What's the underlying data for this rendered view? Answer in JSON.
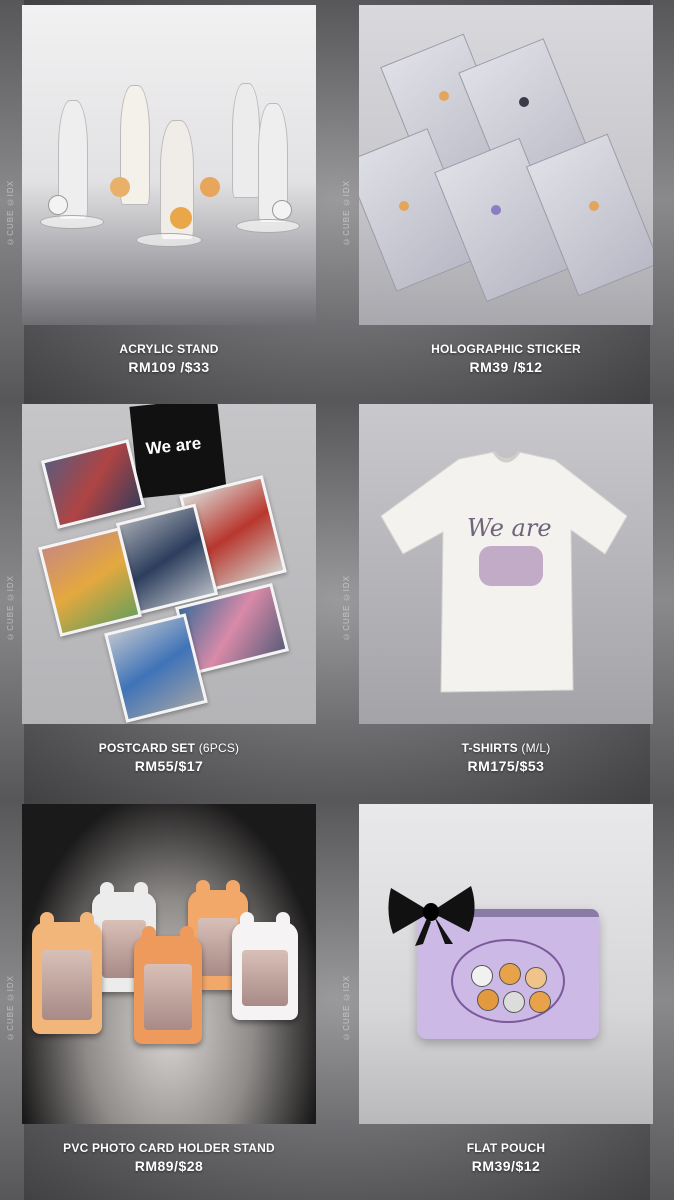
{
  "watermark": "©CUBE ©IDX",
  "products": [
    {
      "name": "ACRYLIC STAND",
      "name_suffix": "",
      "price": "RM109 /$33"
    },
    {
      "name": "HOLOGRAPHIC STICKER",
      "name_suffix": "",
      "price": "RM39 /$12"
    },
    {
      "name": "POSTCARD SET",
      "name_suffix": " (6PCS)",
      "price": "RM55/$17"
    },
    {
      "name": "T-SHIRTS",
      "name_suffix": " (M/L)",
      "price": "RM175/$53"
    },
    {
      "name": "PVC PHOTO CARD HOLDER STAND",
      "name_suffix": "",
      "price": "RM89/$28"
    },
    {
      "name": "FLAT POUCH",
      "name_suffix": "",
      "price": "RM39/$12"
    }
  ],
  "postcard_cover_text": "We are",
  "tshirt_print_text": "We are",
  "colors": {
    "label": "#ffffff",
    "pouch": "#cdb9e6",
    "holder_orange": "#f2a868"
  }
}
